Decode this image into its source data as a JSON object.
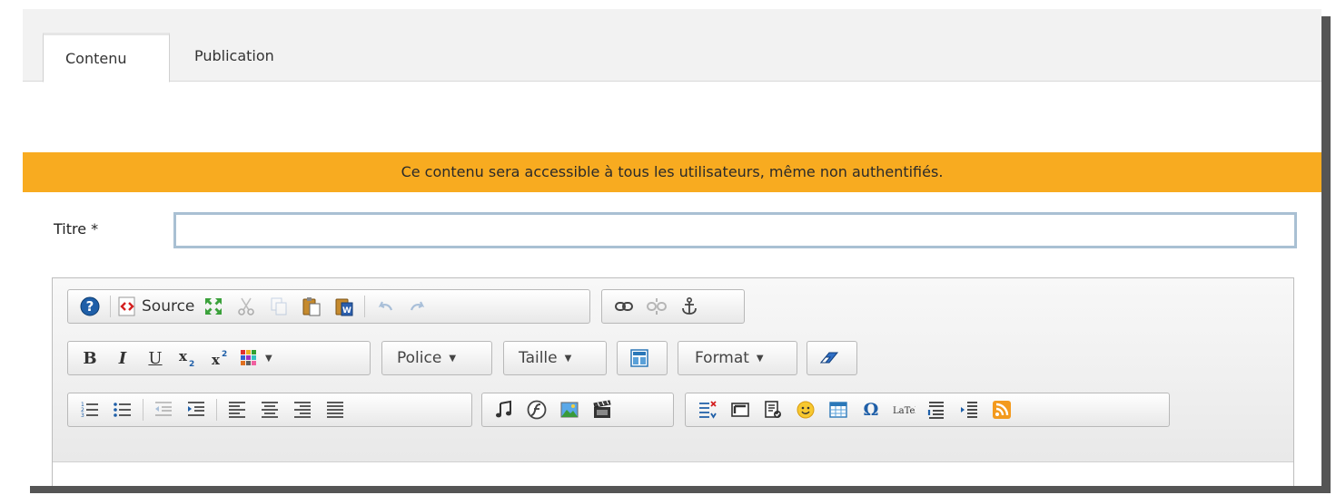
{
  "tabs": [
    {
      "label": "Contenu",
      "active": true
    },
    {
      "label": "Publication",
      "active": false
    }
  ],
  "notice": {
    "text": "Ce contenu sera accessible à tous les utilisateurs, même non authentifiés.",
    "color": "#f8ab20"
  },
  "title_field": {
    "label": "Titre *",
    "value": ""
  },
  "toolbar": {
    "source_label": "Source",
    "font_label": "Police",
    "size_label": "Taille",
    "format_label": "Format"
  },
  "icons": [
    "help-icon",
    "source-icon",
    "maximize-icon",
    "cut-icon",
    "copy-icon",
    "paste-icon",
    "paste-from-word-icon",
    "undo-icon",
    "redo-icon",
    "link-icon",
    "unlink-icon",
    "anchor-icon",
    "bold-icon",
    "italic-icon",
    "underline-icon",
    "subscript-icon",
    "superscript-icon",
    "text-color-icon",
    "templates-icon",
    "remove-format-icon",
    "numbered-list-icon",
    "bulleted-list-icon",
    "outdent-icon",
    "indent-icon",
    "align-left-icon",
    "align-center-icon",
    "align-right-icon",
    "justify-icon",
    "audio-icon",
    "flash-icon",
    "image-icon",
    "video-icon",
    "table-of-contents-icon",
    "iframe-icon",
    "document-icon",
    "smiley-icon",
    "table-icon",
    "special-char-icon",
    "latex-icon",
    "blockquote-icon",
    "insert-list-icon",
    "rss-icon"
  ]
}
